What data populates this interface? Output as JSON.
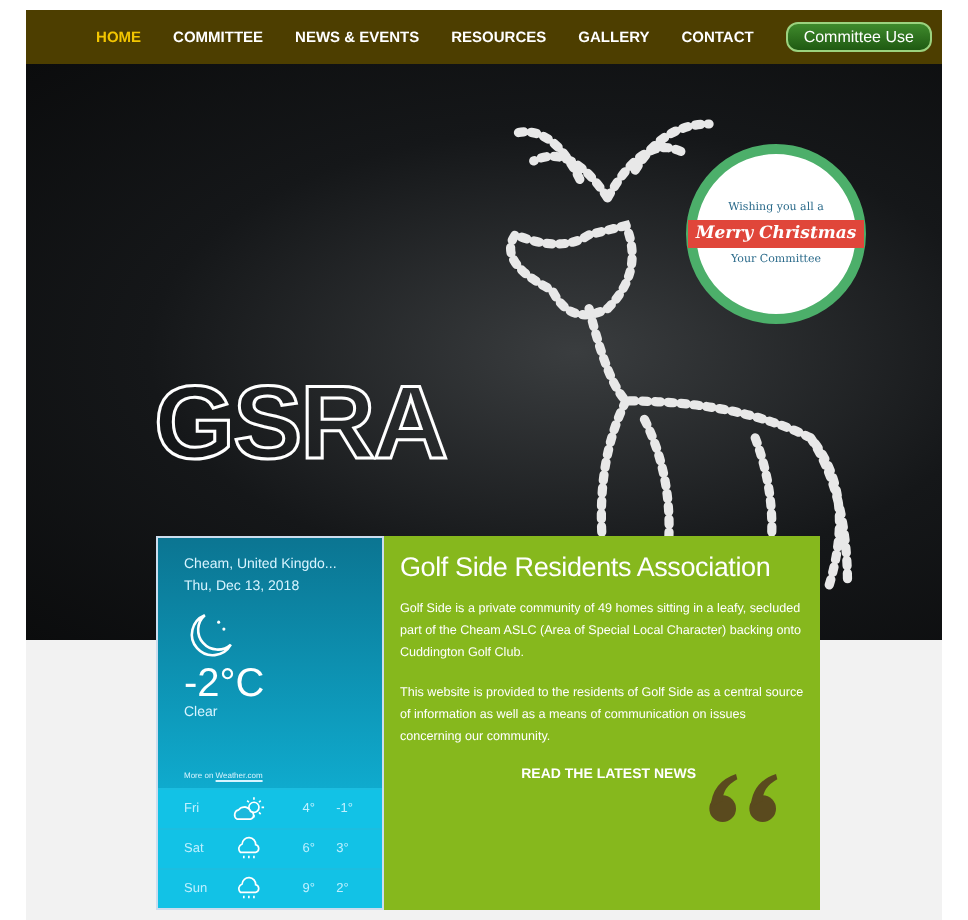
{
  "nav": {
    "items": [
      {
        "label": "HOME",
        "selected": true
      },
      {
        "label": "COMMITTEE",
        "selected": false
      },
      {
        "label": "NEWS & EVENTS",
        "selected": false
      },
      {
        "label": "RESOURCES",
        "selected": false
      },
      {
        "label": "GALLERY",
        "selected": false
      },
      {
        "label": "CONTACT",
        "selected": false
      }
    ],
    "button": "Committee Use"
  },
  "hero": {
    "logo": "GSRA",
    "badge": {
      "top": "Wishing you all a",
      "banner": "Merry Christmas",
      "bottom": "Your Committee"
    }
  },
  "weather": {
    "location": "Cheam, United Kingdo...",
    "date": "Thu, Dec 13, 2018",
    "temperature": "-2°C",
    "condition": "Clear",
    "more_prefix": "More on",
    "more_link": "Weather.com",
    "forecast": [
      {
        "day": "Fri",
        "kind": "partly-cloudy",
        "high": "4°",
        "low": "-1°"
      },
      {
        "day": "Sat",
        "kind": "rain",
        "high": "6°",
        "low": "3°"
      },
      {
        "day": "Sun",
        "kind": "rain",
        "high": "9°",
        "low": "2°"
      }
    ]
  },
  "about": {
    "title": "Golf Side Residents Association",
    "paragraphs": [
      "Golf Side is a private community of 49 homes sitting in a leafy, secluded part of the Cheam ASLC (Area of Special Local Character) backing onto Cuddington Golf Club.",
      "This website is provided to the residents of Golf Side as a central source of information as well as a means of communication on issues concerning our community."
    ],
    "link": "READ THE LATEST NEWS"
  }
}
